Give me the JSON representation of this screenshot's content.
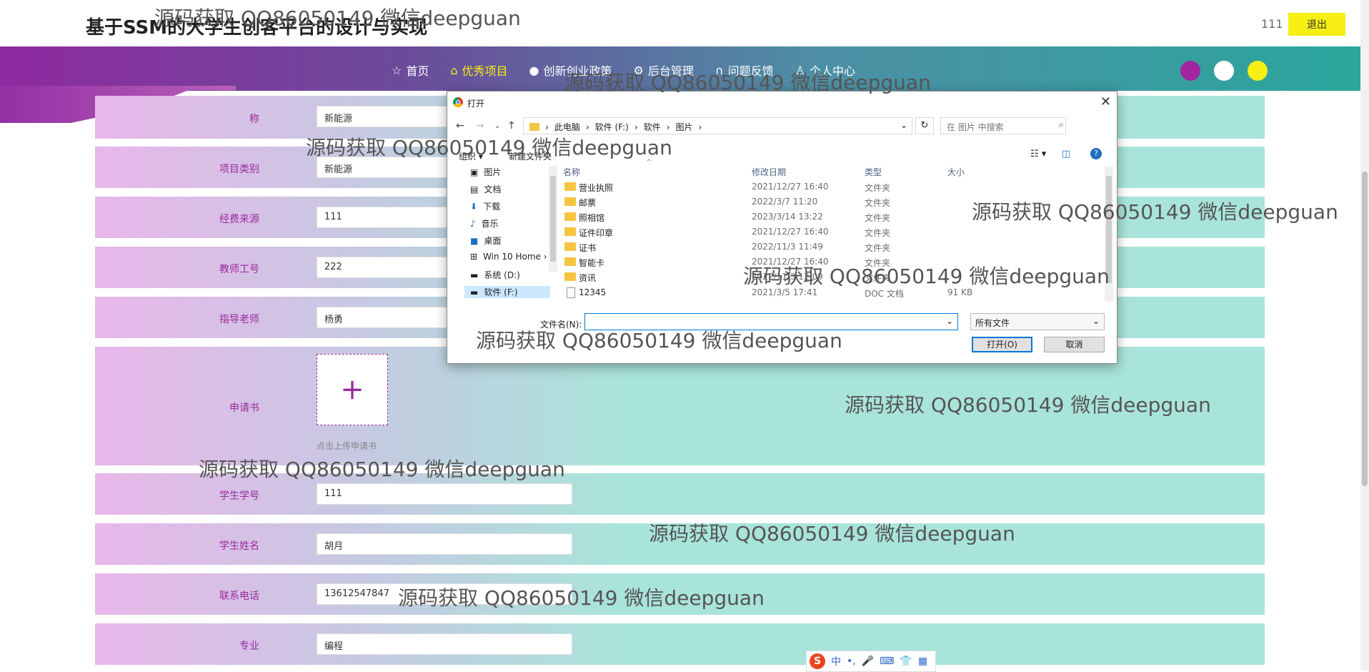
{
  "header": {
    "title": "基于SSM的大学生创客平台的设计与实现",
    "user": "111",
    "logout_label": "退出"
  },
  "nav": {
    "items": [
      {
        "icon": "star-icon",
        "label": "首页"
      },
      {
        "icon": "lock-icon",
        "label": "优秀项目",
        "active": true
      },
      {
        "icon": "info-icon",
        "label": "创新创业政策"
      },
      {
        "icon": "gear-icon",
        "label": "后台管理"
      },
      {
        "icon": "headset-icon",
        "label": "问题反馈"
      },
      {
        "icon": "person-icon",
        "label": "个人中心"
      }
    ],
    "theme_dots": [
      "#a1259e",
      "#ffffff",
      "#f7ee14"
    ]
  },
  "form": {
    "project_name_partial": "称",
    "project_name_value": "新能源",
    "rows": [
      {
        "label": "项目类别",
        "value": "新能源"
      },
      {
        "label": "经费来源",
        "value": "111"
      },
      {
        "label": "教师工号",
        "value": "222"
      },
      {
        "label": "指导老师",
        "value": "杨勇"
      }
    ],
    "upload": {
      "label": "申请书",
      "hint": "点击上传申请书",
      "plus": "+"
    },
    "rows2": [
      {
        "label": "学生学号",
        "value": "111"
      },
      {
        "label": "学生姓名",
        "value": "胡月"
      },
      {
        "label": "联系电话",
        "value": "13612547847"
      },
      {
        "label": "专业",
        "value": "编程"
      }
    ]
  },
  "dialog": {
    "title": "打开",
    "close": "✕",
    "breadcrumb": [
      "此电脑",
      "软件 (F:)",
      "软件",
      "图片"
    ],
    "search_placeholder": "在 图片 中搜索",
    "toolbar": {
      "organize": "组织 ▾",
      "new_folder": "新建文件夹"
    },
    "sidebar": [
      "图片",
      "文档",
      "下载",
      "音乐",
      "桌面",
      "Win 10 Home ›",
      "系统 (D:)",
      "软件 (F:)"
    ],
    "columns": {
      "name": "名称",
      "date": "修改日期",
      "type": "类型",
      "size": "大小"
    },
    "files": [
      {
        "name": "营业执照",
        "date": "2021/12/27 16:40",
        "type": "文件夹",
        "size": ""
      },
      {
        "name": "邮票",
        "date": "2022/3/7 11:20",
        "type": "文件夹",
        "size": ""
      },
      {
        "name": "照相馆",
        "date": "2023/3/14 13:22",
        "type": "文件夹",
        "size": ""
      },
      {
        "name": "证件印章",
        "date": "2021/12/27 16:40",
        "type": "文件夹",
        "size": ""
      },
      {
        "name": "证书",
        "date": "2022/11/3 11:49",
        "type": "文件夹",
        "size": ""
      },
      {
        "name": "智能卡",
        "date": "2021/12/27 16:40",
        "type": "文件夹",
        "size": ""
      },
      {
        "name": "资讯",
        "date": "2022/11/3 12:09",
        "type": "文件夹",
        "size": ""
      },
      {
        "name": "12345",
        "date": "2021/3/5 17:41",
        "type": "DOC 文档",
        "size": "91 KB"
      }
    ],
    "filename_label": "文件名(N):",
    "filename_value": "",
    "filetype": "所有文件",
    "open_label": "打开(O)",
    "cancel_label": "取消"
  },
  "ime": {
    "logo": "S",
    "mode": "中",
    "punct": "•,"
  },
  "watermark": "源码获取 QQ86050149 微信deepguan"
}
